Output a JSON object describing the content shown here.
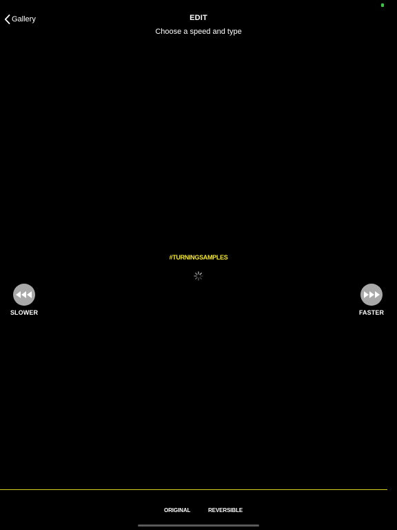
{
  "status": {
    "indicator_color": "#2ecc40"
  },
  "header": {
    "back_label": "Gallery",
    "back_icon": "chevron-left-icon",
    "title": "EDIT",
    "subtitle": "Choose a speed and type"
  },
  "preview": {
    "hashtag": "#TURNINGSAMPLES",
    "hashtag_color": "#f5e72a",
    "loading_icon": "spinner-icon"
  },
  "controls": {
    "slower": {
      "label": "SLOWER",
      "icon": "rewind-icon"
    },
    "faster": {
      "label": "FASTER",
      "icon": "fast-forward-icon"
    }
  },
  "type_selector": {
    "divider_color": "#d8d21e",
    "options": [
      {
        "label": "ORIGINAL"
      },
      {
        "label": "REVERSIBLE"
      }
    ]
  }
}
